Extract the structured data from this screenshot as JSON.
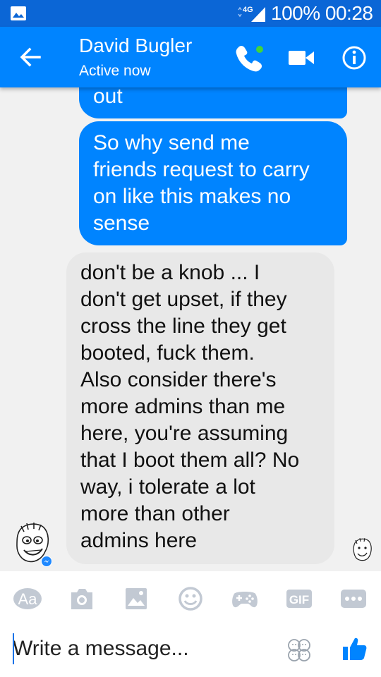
{
  "status_bar": {
    "network": "4G",
    "battery": "100%",
    "time": "00:28"
  },
  "header": {
    "name": "David Bugler",
    "status": "Active now",
    "icons": [
      "back-arrow-icon",
      "phone-icon",
      "video-camera-icon",
      "info-icon"
    ],
    "accent": "#0084ff",
    "active_dot": "#42d43a"
  },
  "messages": [
    {
      "from": "me",
      "text": "out"
    },
    {
      "from": "me",
      "text": "So why send me\nfriends request to carry\non like this makes no\nsense"
    },
    {
      "from": "David Bugler",
      "text": "don't be a knob ... I\ndon't get upset, if they\ncross the line they get\nbooted, fuck them.\nAlso consider there's\nmore admins than me\nhere, you're assuming\nthat I boot them all? No\nway, i tolerate a lot\nmore than other\nadmins here"
    }
  ],
  "composer": {
    "tools": {
      "text_style": "Aa",
      "gif": "GIF",
      "icons": [
        "text-style-icon",
        "camera-icon",
        "gallery-icon",
        "emoji-icon",
        "game-controller-icon",
        "gif-icon",
        "more-icon"
      ]
    },
    "placeholder": "Write a message...",
    "send_icon": "thumbs-up-icon"
  }
}
